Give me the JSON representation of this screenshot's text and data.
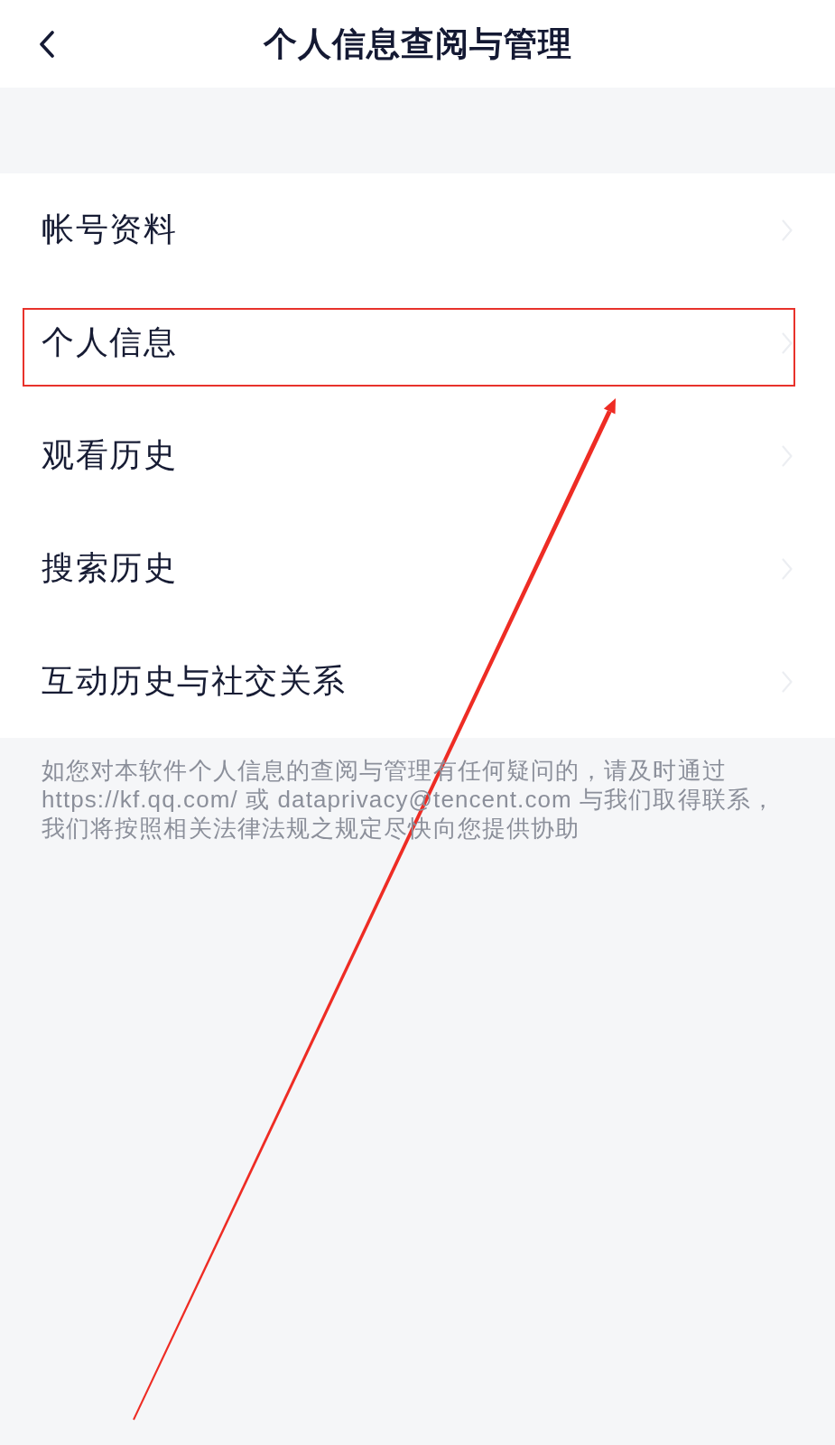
{
  "header": {
    "title": "个人信息查阅与管理"
  },
  "menu": {
    "items": [
      {
        "label": "帐号资料",
        "highlighted": false
      },
      {
        "label": "个人信息",
        "highlighted": true
      },
      {
        "label": "观看历史",
        "highlighted": false
      },
      {
        "label": "搜索历史",
        "highlighted": false
      },
      {
        "label": "互动历史与社交关系",
        "highlighted": false
      }
    ]
  },
  "footnote": "如您对本软件个人信息的查阅与管理有任何疑问的，请及时通过https://kf.qq.com/ 或 dataprivacy@tencent.com 与我们取得联系，我们将按照相关法律法规之规定尽快向您提供协助"
}
